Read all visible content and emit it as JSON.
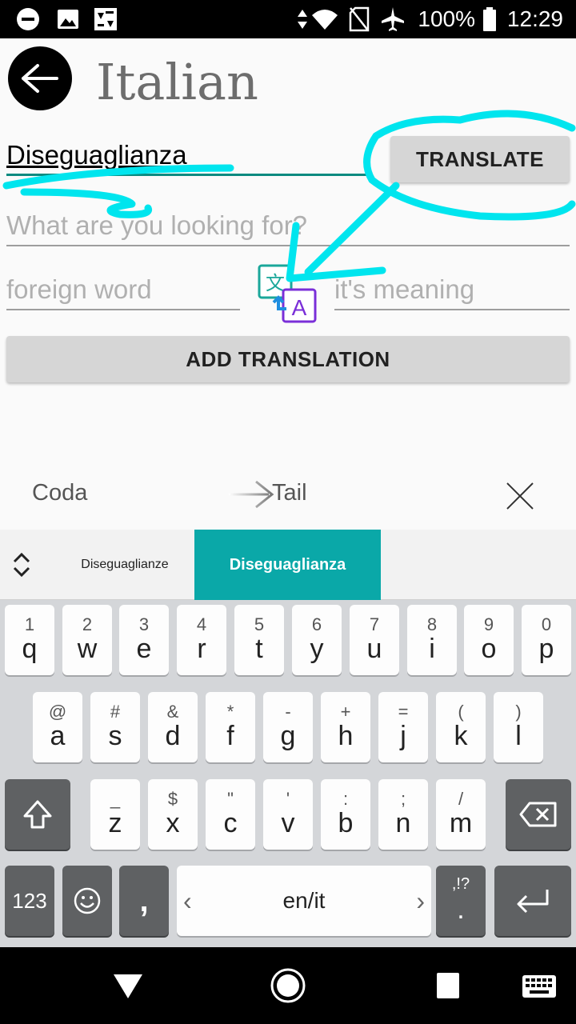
{
  "status_bar": {
    "battery_percent": "100%",
    "time": "12:29"
  },
  "header": {
    "title": "Italian"
  },
  "form": {
    "word_value": "Diseguaglianza",
    "translate_label": "TRANSLATE",
    "search_placeholder": "What are you looking for?",
    "foreign_placeholder": "foreign word",
    "meaning_placeholder": "it's meaning",
    "add_label": "ADD TRANSLATION"
  },
  "suggestion": {
    "source": "Coda",
    "target": "Tail"
  },
  "keyboard": {
    "suggestions": [
      "Diseguaglianze",
      "Diseguaglianza"
    ],
    "row1": [
      {
        "hint": "1",
        "key": "q"
      },
      {
        "hint": "2",
        "key": "w"
      },
      {
        "hint": "3",
        "key": "e"
      },
      {
        "hint": "4",
        "key": "r"
      },
      {
        "hint": "5",
        "key": "t"
      },
      {
        "hint": "6",
        "key": "y"
      },
      {
        "hint": "7",
        "key": "u"
      },
      {
        "hint": "8",
        "key": "i"
      },
      {
        "hint": "9",
        "key": "o"
      },
      {
        "hint": "0",
        "key": "p"
      }
    ],
    "row2": [
      {
        "hint": "@",
        "key": "a"
      },
      {
        "hint": "#",
        "key": "s"
      },
      {
        "hint": "&",
        "key": "d"
      },
      {
        "hint": "*",
        "key": "f"
      },
      {
        "hint": "-",
        "key": "g"
      },
      {
        "hint": "+",
        "key": "h"
      },
      {
        "hint": "=",
        "key": "j"
      },
      {
        "hint": "(",
        "key": "k"
      },
      {
        "hint": ")",
        "key": "l"
      }
    ],
    "row3": [
      {
        "hint": "_",
        "key": "z"
      },
      {
        "hint": "$",
        "key": "x"
      },
      {
        "hint": "\"",
        "key": "c"
      },
      {
        "hint": "'",
        "key": "v"
      },
      {
        "hint": ":",
        "key": "b"
      },
      {
        "hint": ";",
        "key": "n"
      },
      {
        "hint": "/",
        "key": "m"
      }
    ],
    "numbers_label": "123",
    "comma_label": ",",
    "space_label": "en/it",
    "punct_hint": ",!?",
    "period_label": "."
  },
  "colors": {
    "accent": "#0aa8a8",
    "annotation": "#00e5ee",
    "field_active": "#0b8a80"
  }
}
